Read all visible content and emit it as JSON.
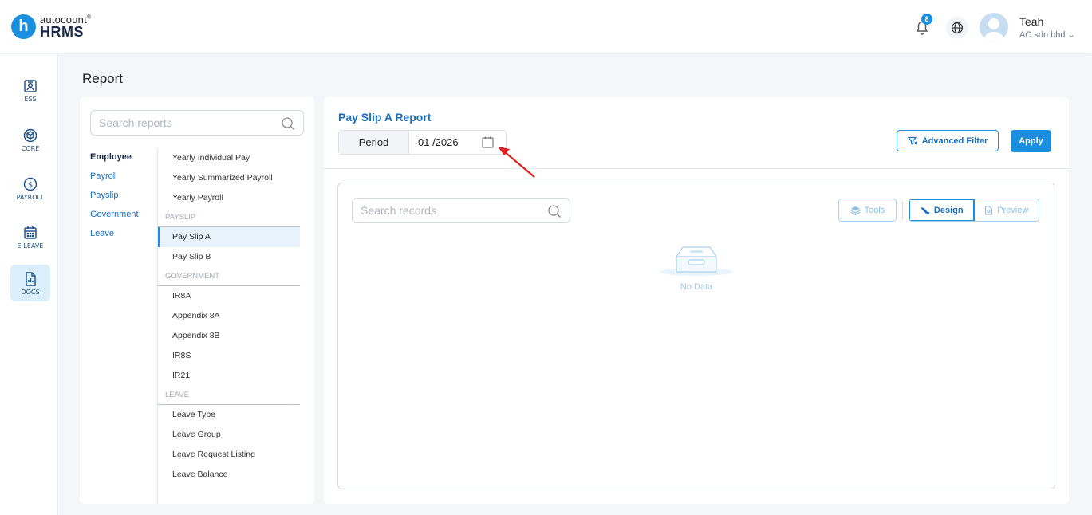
{
  "app": {
    "logo_letter": "h",
    "logo_line1": "autocount",
    "logo_line2": "HRMS",
    "brand_color": "#1a8fe0"
  },
  "header": {
    "notification_count": "8",
    "user_name": "Teah",
    "user_org": "AC sdn bhd"
  },
  "nav": [
    {
      "label": "ESS",
      "icon": "ess-icon"
    },
    {
      "label": "CORE",
      "icon": "core-icon"
    },
    {
      "label": "PAYROLL",
      "icon": "payroll-icon"
    },
    {
      "label": "E-LEAVE",
      "icon": "calendar-icon"
    },
    {
      "label": "DOCS",
      "icon": "docs-icon",
      "active": true
    }
  ],
  "page": {
    "title": "Report"
  },
  "report_sidebar": {
    "search_placeholder": "Search reports",
    "categories": [
      "Employee",
      "Payroll",
      "Payslip",
      "Government",
      "Leave"
    ],
    "items_top": [
      "Yearly Individual Pay",
      "Yearly Summarized Payroll",
      "Yearly Payroll"
    ],
    "sec_payslip": "PAYSLIP",
    "items_payslip": [
      "Pay Slip A",
      "Pay Slip B"
    ],
    "sec_government": "GOVERNMENT",
    "items_government": [
      "IR8A",
      "Appendix 8A",
      "Appendix 8B",
      "IR8S",
      "IR21"
    ],
    "sec_leave": "LEAVE",
    "items_leave": [
      "Leave Type",
      "Leave Group",
      "Leave Request Listing",
      "Leave Balance"
    ]
  },
  "main": {
    "title": "Pay Slip A Report",
    "period_label": "Period",
    "period_value": "01 /2026",
    "advanced_filter_label": "Advanced Filter",
    "apply_label": "Apply",
    "records_search_placeholder": "Search records",
    "tools_label": "Tools",
    "design_label": "Design",
    "preview_label": "Preview",
    "no_data_text": "No Data"
  }
}
